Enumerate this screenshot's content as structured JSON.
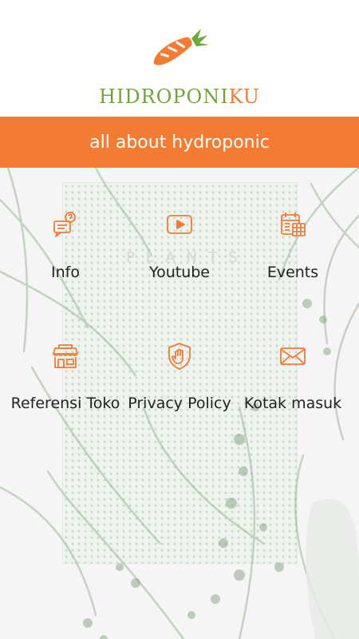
{
  "header": {
    "brand_prefix": "HIDROPONI",
    "brand_suffix": "KU",
    "tagline": "all about hydroponic"
  },
  "background": {
    "board_text": "PLANTS"
  },
  "menu": {
    "items": [
      {
        "label": "Info",
        "icon": "info-chat-icon"
      },
      {
        "label": "Youtube",
        "icon": "youtube-play-icon"
      },
      {
        "label": "Events",
        "icon": "calendar-icon"
      },
      {
        "label": "Referensi Toko",
        "icon": "store-icon"
      },
      {
        "label": "Privacy Policy",
        "icon": "shield-hand-icon"
      },
      {
        "label": "Kotak masuk",
        "icon": "envelope-icon"
      }
    ]
  },
  "colors": {
    "accent_orange": "#f47c32",
    "brand_green": "#74a23a",
    "brand_orange": "#f07b36"
  }
}
